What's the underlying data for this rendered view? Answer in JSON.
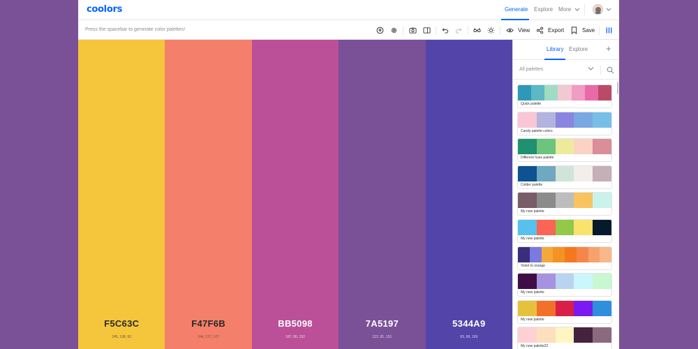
{
  "nav": {
    "logo": "coolors",
    "generate": "Generate",
    "explore": "Explore",
    "more": "More"
  },
  "toolbar": {
    "hint": "Press the spacebar to generate color palettes!",
    "view": "View",
    "export": "Export",
    "save": "Save"
  },
  "colors": [
    {
      "hex": "F5C63C",
      "rgb": "245, 198, 60",
      "tone": "light"
    },
    {
      "hex": "F47F6B",
      "rgb": "244, 127, 107",
      "tone": "light"
    },
    {
      "hex": "BB5098",
      "rgb": "187, 80, 152",
      "tone": "dark"
    },
    {
      "hex": "7A5197",
      "rgb": "122, 81, 151",
      "tone": "dark"
    },
    {
      "hex": "5344A9",
      "rgb": "83, 68, 169",
      "tone": "dark"
    }
  ],
  "panel": {
    "tab_library": "Library",
    "tab_explore": "Explore",
    "filter": "All palettes",
    "palettes": [
      {
        "name": "Quick palette",
        "colors": [
          "#2e98b8",
          "#5cb8c4",
          "#9fdcc4",
          "#f0c9d3",
          "#f09cc3",
          "#e96aa8",
          "#b94b67"
        ]
      },
      {
        "name": "Candy palette colors",
        "colors": [
          "#f9c6d6",
          "#b3b3e0",
          "#8a85e0",
          "#7aa8e0",
          "#78bfe8"
        ]
      },
      {
        "name": "Different hues palette",
        "colors": [
          "#1f9070",
          "#6cc47e",
          "#eeea9c",
          "#fcd2c4",
          "#d98e98"
        ]
      },
      {
        "name": "Colder palette",
        "colors": [
          "#0f5292",
          "#6fa8c0",
          "#d2e4d9",
          "#f3eee9",
          "#c4b0b6"
        ]
      },
      {
        "name": "My new palette",
        "colors": [
          "#7a5b68",
          "#8a8b8a",
          "#bdbdbd",
          "#f8c460",
          "#c9f3ea"
        ]
      },
      {
        "name": "My new palette",
        "colors": [
          "#56c1ee",
          "#fb6555",
          "#94c848",
          "#f9e36c",
          "#071a2c"
        ]
      },
      {
        "name": "Violet to orange",
        "colors": [
          "#3b2d7c",
          "#7a7ae0",
          "#f5a83a",
          "#f49226",
          "#f4781e",
          "#f5864a",
          "#f7a26c",
          "#f9b88a"
        ]
      },
      {
        "name": "My new palette",
        "colors": [
          "#3f0c43",
          "#a792e0",
          "#b9d4f0",
          "#caf7fc",
          "#c8f7d0"
        ]
      },
      {
        "name": "My new palette",
        "colors": [
          "#e6c13c",
          "#f2712a",
          "#d81f48",
          "#7b1af0",
          "#2e8fdc"
        ]
      },
      {
        "name": "My new palette22",
        "colors": [
          "#fdd1d4",
          "#fbdfbf",
          "#fef5c2",
          "#45233e",
          "#8b6a80"
        ]
      }
    ]
  }
}
